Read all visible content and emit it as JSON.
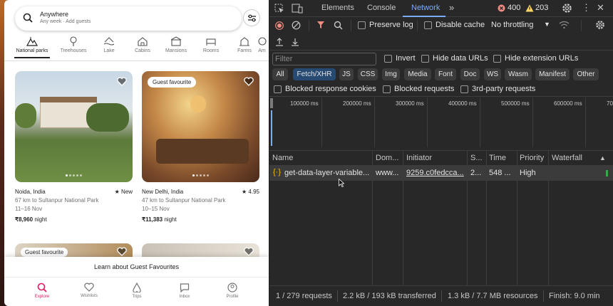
{
  "airbnb": {
    "search": {
      "title": "Anywhere",
      "subtitle": "Any week · Add guests"
    },
    "categories": [
      {
        "label": "National parks",
        "icon": "national-parks-icon"
      },
      {
        "label": "Treehouses",
        "icon": "treehouse-icon"
      },
      {
        "label": "Lake",
        "icon": "lake-icon"
      },
      {
        "label": "Cabins",
        "icon": "cabin-icon"
      },
      {
        "label": "Mansions",
        "icon": "mansion-icon"
      },
      {
        "label": "Rooms",
        "icon": "rooms-icon"
      },
      {
        "label": "Farms",
        "icon": "farm-icon"
      },
      {
        "label": "Am",
        "icon": "amazing-icon"
      }
    ],
    "listings": [
      {
        "location": "Noida, India",
        "rating": "New",
        "distance": "67 km to Sultanpur National Park",
        "dates": "11–16 Nov",
        "price": "₹8,960",
        "price_suffix": "night",
        "badge": ""
      },
      {
        "location": "New Delhi, India",
        "rating": "4.95",
        "distance": "47 km to Sultanpur National Park",
        "dates": "10–15 Nov",
        "price": "₹11,383",
        "price_suffix": "night",
        "badge": "Guest favourite"
      }
    ],
    "partial_badge": "Guest favourite",
    "banner": "Learn about Guest Favourites",
    "nav": [
      {
        "label": "Explore",
        "icon": "search-icon"
      },
      {
        "label": "Wishlists",
        "icon": "heart-icon"
      },
      {
        "label": "Trips",
        "icon": "airbnb-logo-icon"
      },
      {
        "label": "Inbox",
        "icon": "message-icon"
      },
      {
        "label": "Profile",
        "icon": "profile-icon"
      }
    ]
  },
  "devtools": {
    "tabs": [
      "Elements",
      "Console",
      "Network"
    ],
    "errors": "400",
    "warnings": "203",
    "toolbar": {
      "preserve_log": "Preserve log",
      "disable_cache": "Disable cache",
      "throttling": "No throttling"
    },
    "filter": {
      "placeholder": "Filter",
      "invert": "Invert",
      "hide_data_urls": "Hide data URLs",
      "hide_ext_urls": "Hide extension URLs"
    },
    "type_filters": [
      "All",
      "Fetch/XHR",
      "JS",
      "CSS",
      "Img",
      "Media",
      "Font",
      "Doc",
      "WS",
      "Wasm",
      "Manifest",
      "Other"
    ],
    "blocked": {
      "cookies": "Blocked response cookies",
      "requests": "Blocked requests",
      "third_party": "3rd-party requests"
    },
    "timeline_ticks": [
      "100000 ms",
      "200000 ms",
      "300000 ms",
      "400000 ms",
      "500000 ms",
      "600000 ms",
      "70"
    ],
    "columns": [
      "Name",
      "Dom...",
      "Initiator",
      "S...",
      "Time",
      "Priority",
      "Waterfall"
    ],
    "request": {
      "name": "get-data-layer-variable...",
      "domain": "www...",
      "initiator": "9259.c0fedcca...",
      "status": "2...",
      "time": "548 ...",
      "priority": "High"
    },
    "status": {
      "requests": "1 / 279 requests",
      "transferred": "2.2 kB / 193 kB transferred",
      "resources": "1.3 kB / 7.7 MB resources",
      "finish": "Finish: 9.0 min"
    },
    "colors": {
      "accent": "#7cacf8",
      "error": "#f28b82",
      "warning": "#fdd663"
    }
  }
}
